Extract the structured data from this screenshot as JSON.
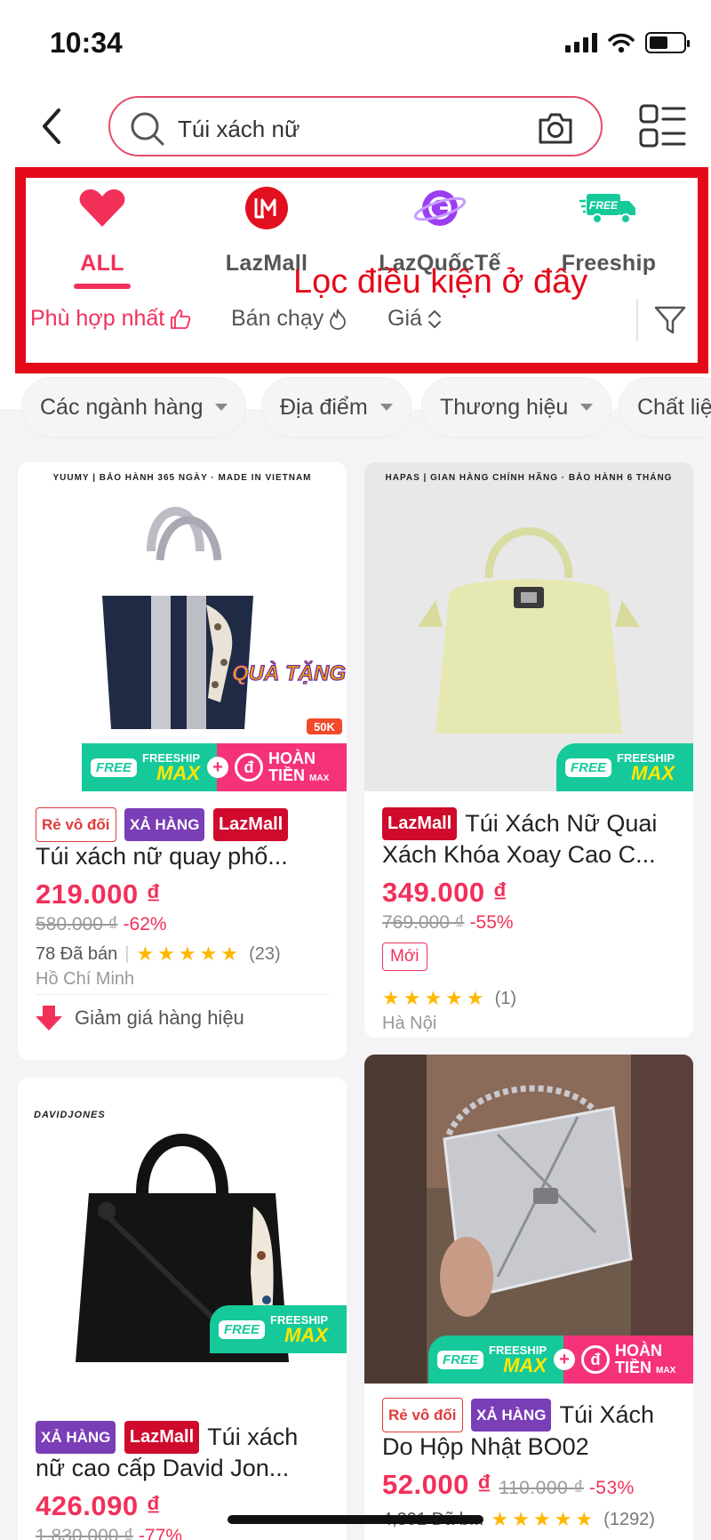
{
  "status_bar": {
    "time": "10:34",
    "battery_level": 0.55
  },
  "search": {
    "value": "Túi xách nữ"
  },
  "category_tabs": [
    {
      "label": "ALL",
      "active": true,
      "icon": "heart-icon"
    },
    {
      "label": "LazMall",
      "active": false,
      "icon": "lazmall-logo-icon"
    },
    {
      "label": "LazQuốcTế",
      "active": false,
      "icon": "globe-icon"
    },
    {
      "label": "Freeship",
      "active": false,
      "icon": "truck-icon"
    }
  ],
  "annotation": "Lọc điều kiện ở đây",
  "sort": [
    {
      "label": "Phù hợp nhất",
      "active": true,
      "icon": "thumbs-up-icon"
    },
    {
      "label": "Bán chạy",
      "active": false,
      "icon": "flame-icon"
    },
    {
      "label": "Giá",
      "active": false,
      "icon": "sort-arrows-icon"
    }
  ],
  "chips": [
    "Các ngành hàng",
    "Địa điểm",
    "Thương hiệu",
    "Chất liệ"
  ],
  "colors": {
    "accent": "#f2305a",
    "highlight": "#e5091a",
    "lazmall": "#cf0a2c",
    "xahang": "#7a3eb7",
    "freeship": "#16c99b"
  },
  "products": [
    {
      "brand": "YUUMY | BẢO HÀNH 365 NGÀY · MADE IN VIETNAM",
      "sticker": "QUÀ TẶNG",
      "sticker_tag": "50K",
      "ship_a": "FREESHIP",
      "ship_b": "MAX",
      "ship_free": "FREE",
      "refund_a": "HOÀN",
      "refund_b": "TIỀN",
      "refund_c": "MAX",
      "badges": [
        "Rẻ vô đối",
        "XẢ HÀNG",
        "LazMall"
      ],
      "title": "Túi xách nữ quay phố...",
      "price": "219.000 ₫",
      "old_price": "580.000 ₫",
      "discount": "-62%",
      "sold": "78 Đã bán",
      "rating_count": "(23)",
      "location": "Hồ Chí Minh",
      "promo": "Giảm giá hàng hiệu"
    },
    {
      "brand": "HAPAS | GIAN HÀNG CHÍNH HÃNG · BẢO HÀNH 6 THÁNG",
      "ship_a": "FREESHIP",
      "ship_b": "MAX",
      "ship_free": "FREE",
      "badges": [
        "LazMall"
      ],
      "title": "Túi Xách Nữ Quai Xách Khóa Xoay Cao C...",
      "price": "349.000 ₫",
      "old_price": "769.000 ₫",
      "discount": "-55%",
      "tag": "Mới",
      "rating_count": "(1)",
      "location": "Hà Nội"
    },
    {
      "brand": "DAVIDJONES",
      "ship_a": "FREESHIP",
      "ship_b": "MAX",
      "ship_free": "FREE",
      "badges": [
        "XẢ HÀNG",
        "LazMall"
      ],
      "title": "Túi xách nữ cao cấp David Jon...",
      "price": "426.090 ₫",
      "old_price": "1.830.000 ₫",
      "discount": "-77%"
    },
    {
      "ship_a": "FREESHIP",
      "ship_b": "MAX",
      "ship_free": "FREE",
      "refund_a": "HOÀN",
      "refund_b": "TIỀN",
      "refund_c": "MAX",
      "badges": [
        "Rẻ vô đối",
        "XẢ HÀNG"
      ],
      "title": "Túi Xách Do Hộp Nhật BO02",
      "price": "52.000 ₫",
      "old_price": "110.000 ₫",
      "discount": "-53%",
      "sold": "4,391 Đã b...",
      "rating_count": "(1292)"
    }
  ]
}
